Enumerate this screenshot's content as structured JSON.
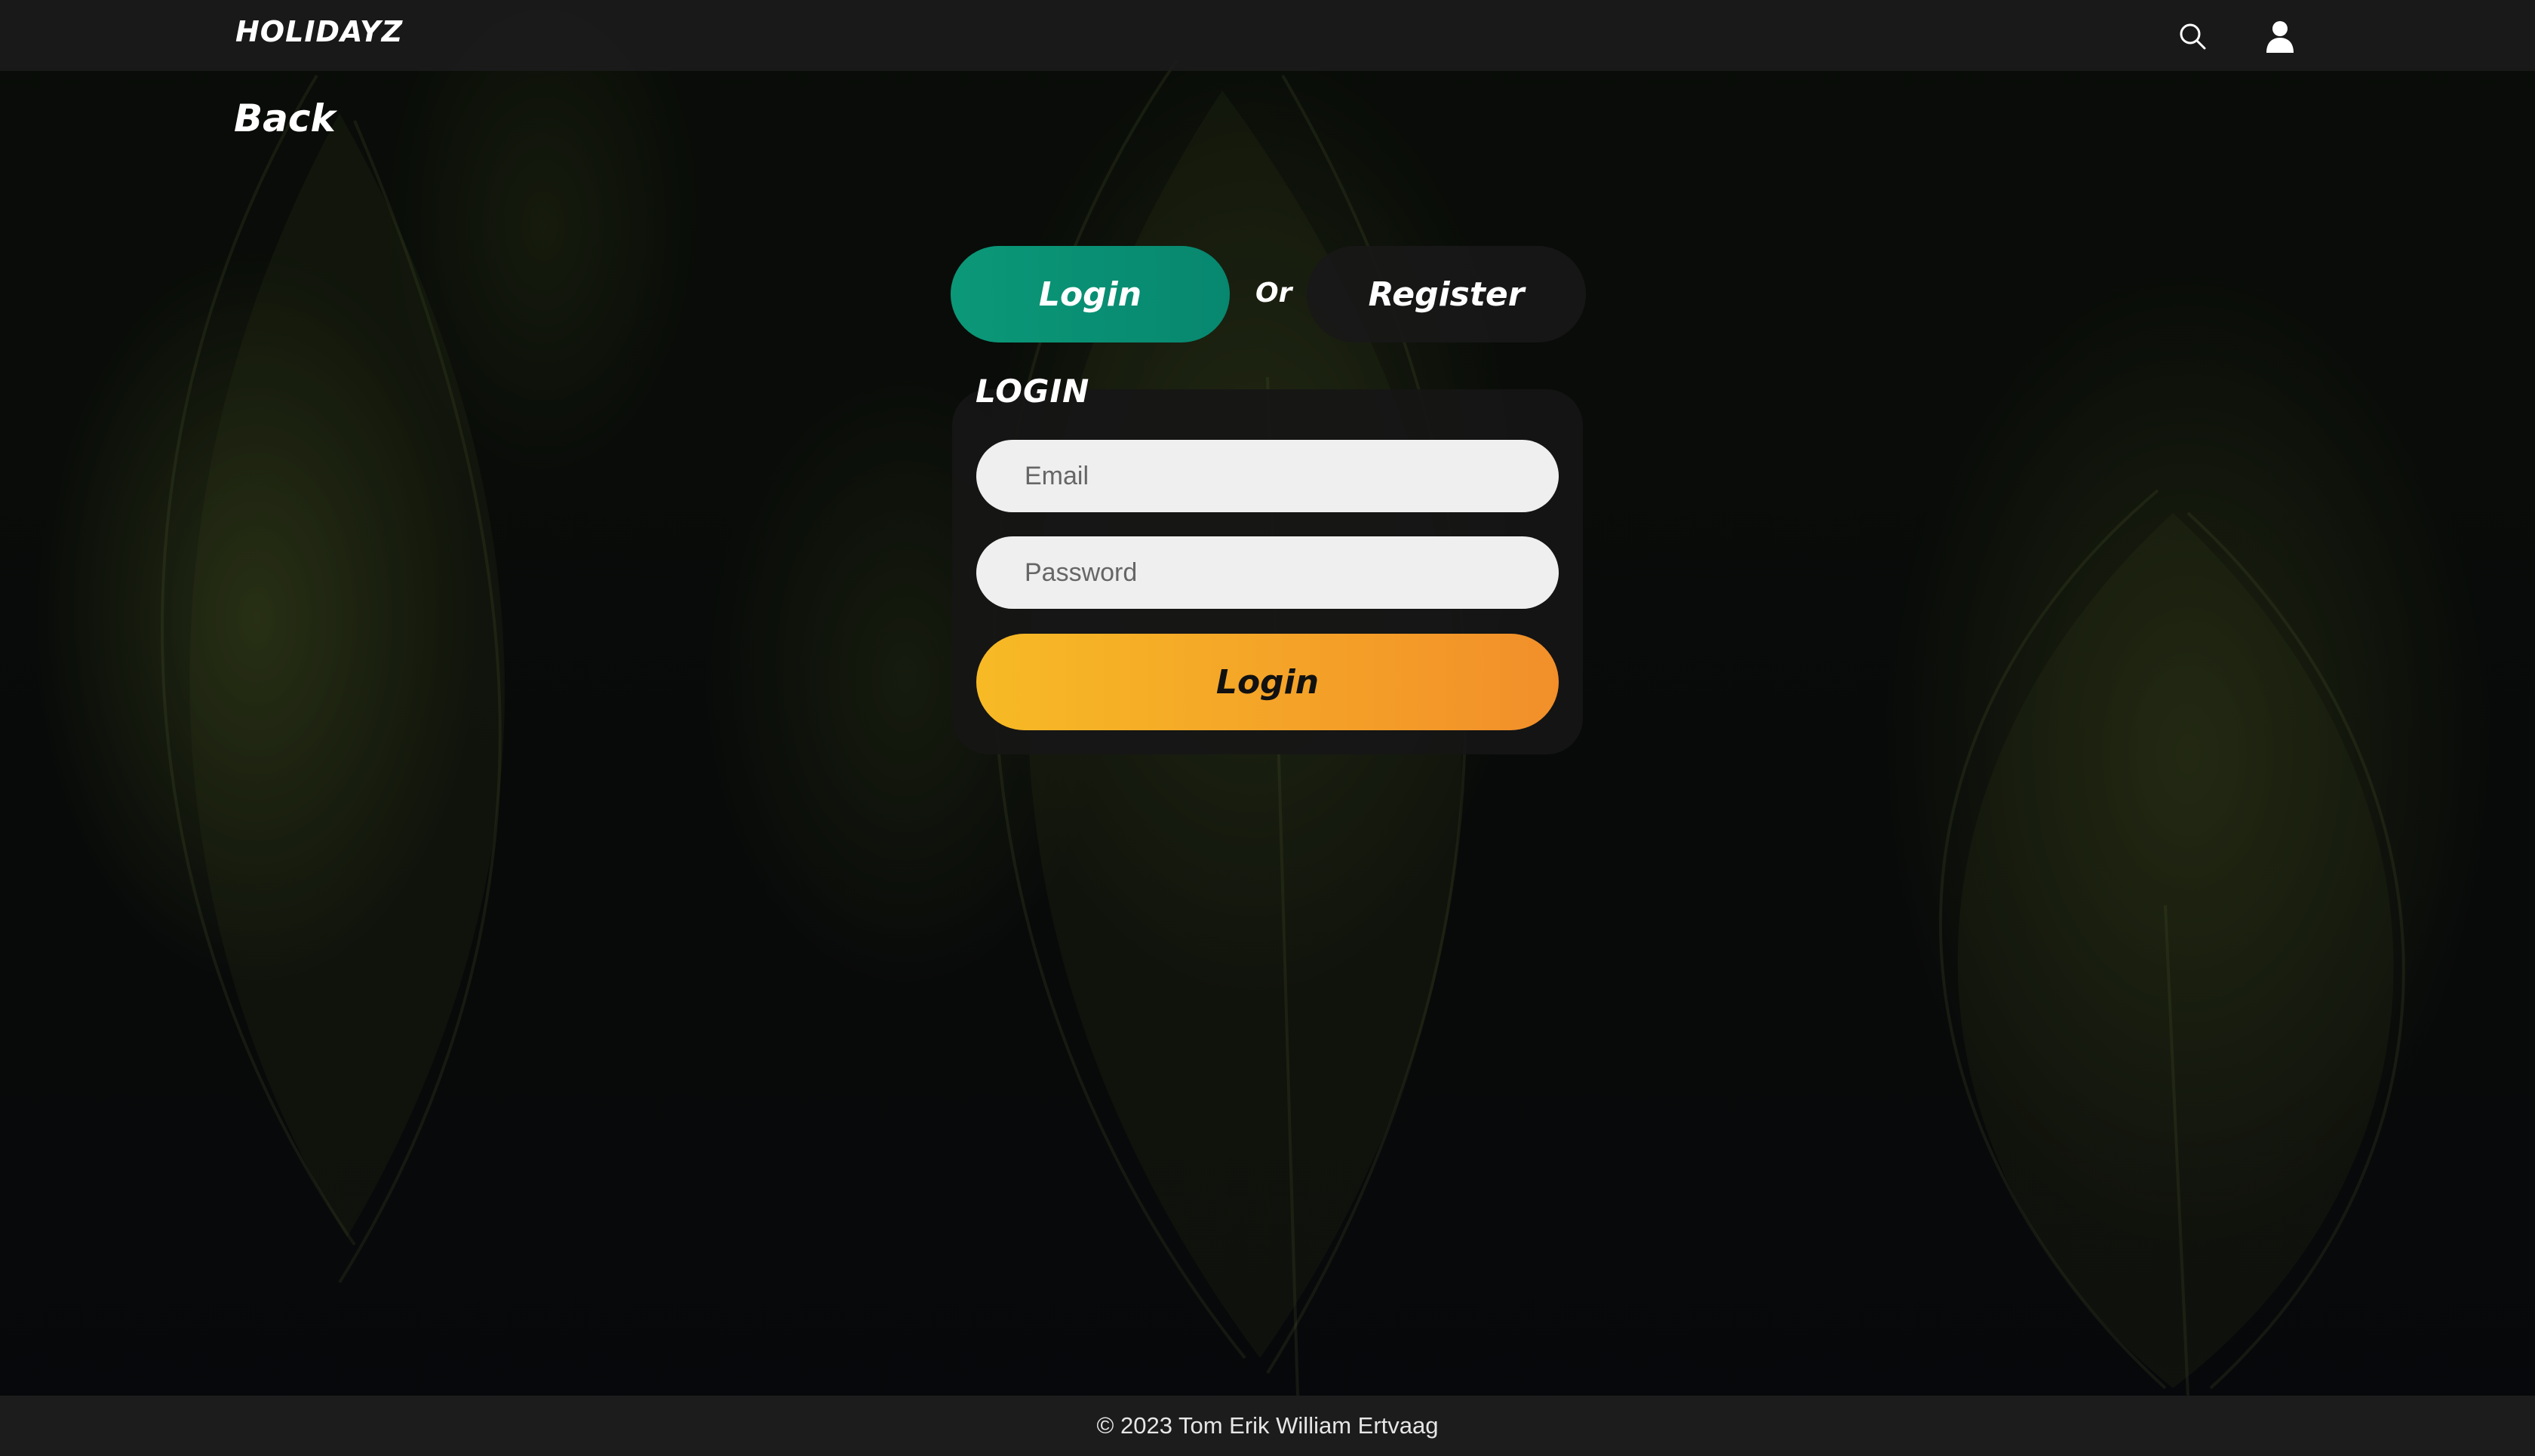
{
  "header": {
    "logo": "HOLIDAYZ",
    "search_icon": "search-icon",
    "user_icon": "user-icon"
  },
  "nav": {
    "back_label": "Back"
  },
  "toggle": {
    "login_label": "Login",
    "or_label": "Or",
    "register_label": "Register",
    "active": "Login"
  },
  "form": {
    "title": "LOGIN",
    "email_placeholder": "Email",
    "email_value": "",
    "password_placeholder": "Password",
    "password_value": "",
    "submit_label": "Login"
  },
  "footer": {
    "copyright": "© 2023 Tom Erik William Ertvaag"
  },
  "colors": {
    "login_tab": "#0b9878",
    "register_tab": "#181818",
    "submit_start": "#f7ba25",
    "submit_end": "#f28f2a",
    "field_bg": "#efefef",
    "topbar": "#1b1b1b",
    "footer": "#1c1c1c"
  }
}
